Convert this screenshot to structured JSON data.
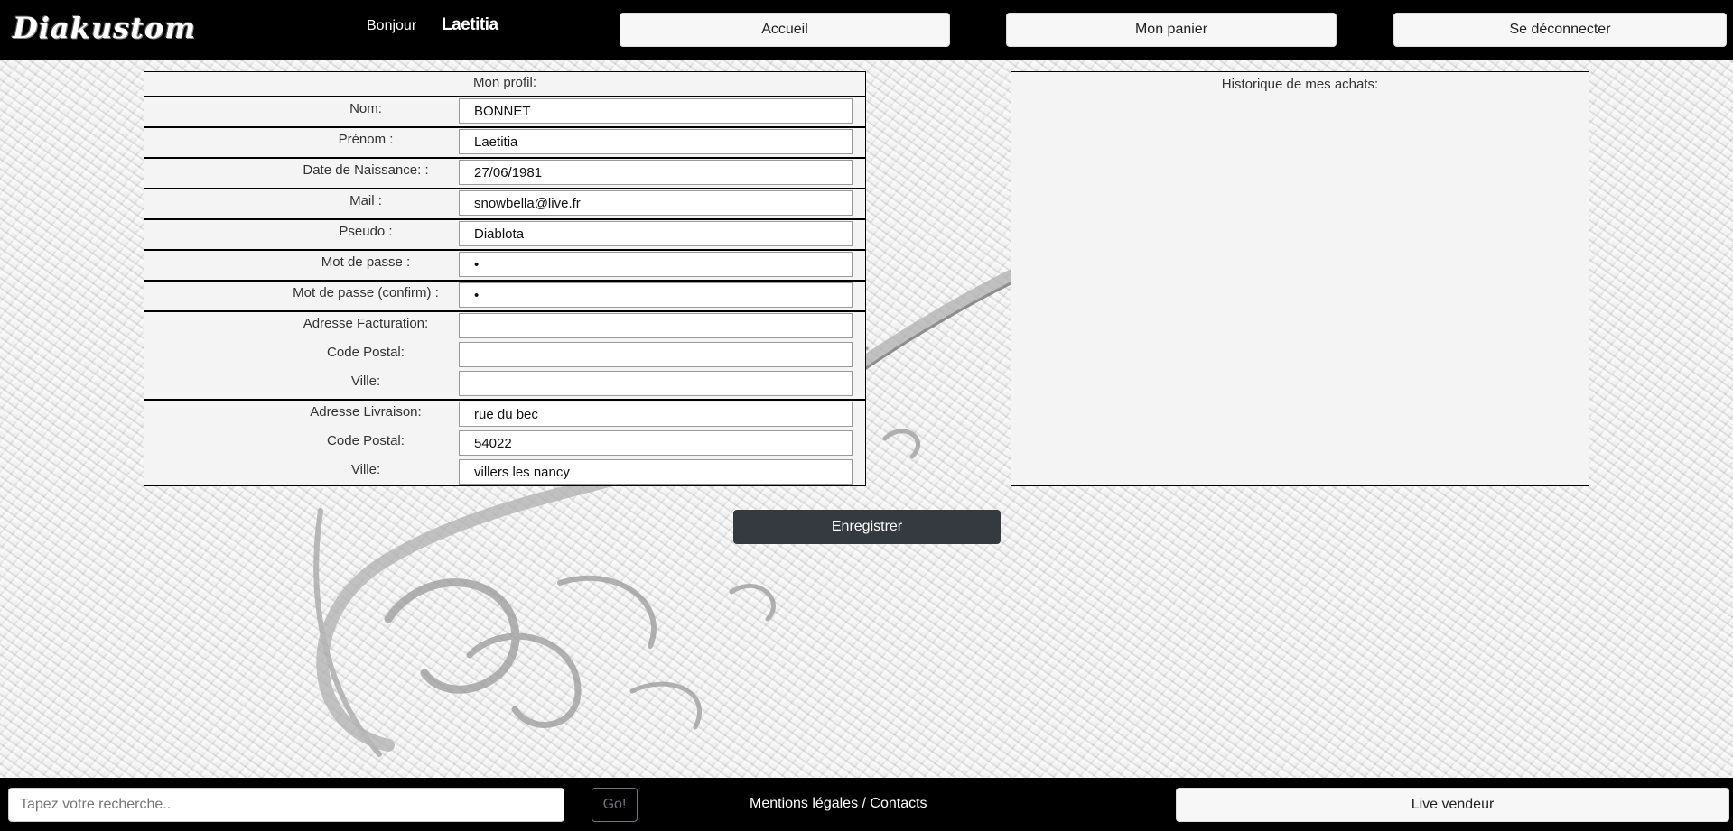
{
  "header": {
    "logo": "Diakustom",
    "greeting": "Bonjour",
    "username": "Laetitia",
    "nav": {
      "home": "Accueil",
      "cart": "Mon panier",
      "logout": "Se déconnecter"
    }
  },
  "profile": {
    "title": "Mon profil:",
    "fields": {
      "nom": {
        "label": "Nom:",
        "value": "BONNET"
      },
      "prenom": {
        "label": "Prénom :",
        "value": "Laetitia"
      },
      "naissance": {
        "label": "Date de Naissance: :",
        "value": "27/06/1981"
      },
      "mail": {
        "label": "Mail :",
        "value": "snowbella@live.fr"
      },
      "pseudo": {
        "label": "Pseudo :",
        "value": "Diablota"
      },
      "password": {
        "label": "Mot de passe :",
        "value": "•"
      },
      "password_confirm": {
        "label": "Mot de passe (confirm) :",
        "value": "•"
      }
    },
    "billing": {
      "address": {
        "label": "Adresse Facturation:",
        "value": ""
      },
      "postal": {
        "label": "Code Postal:",
        "value": ""
      },
      "city": {
        "label": "Ville:",
        "value": ""
      }
    },
    "delivery": {
      "address": {
        "label": "Adresse Livraison:",
        "value": "rue du bec"
      },
      "postal": {
        "label": "Code Postal:",
        "value": "54022"
      },
      "city": {
        "label": "Ville:",
        "value": "villers les nancy"
      }
    }
  },
  "history": {
    "title": "Historique de mes achats:"
  },
  "save_label": "Enregistrer",
  "footer": {
    "search_placeholder": "Tapez votre recherche..",
    "go_label": "Go!",
    "mentions": "Mentions légales / Contacts",
    "live_seller": "Live vendeur"
  }
}
